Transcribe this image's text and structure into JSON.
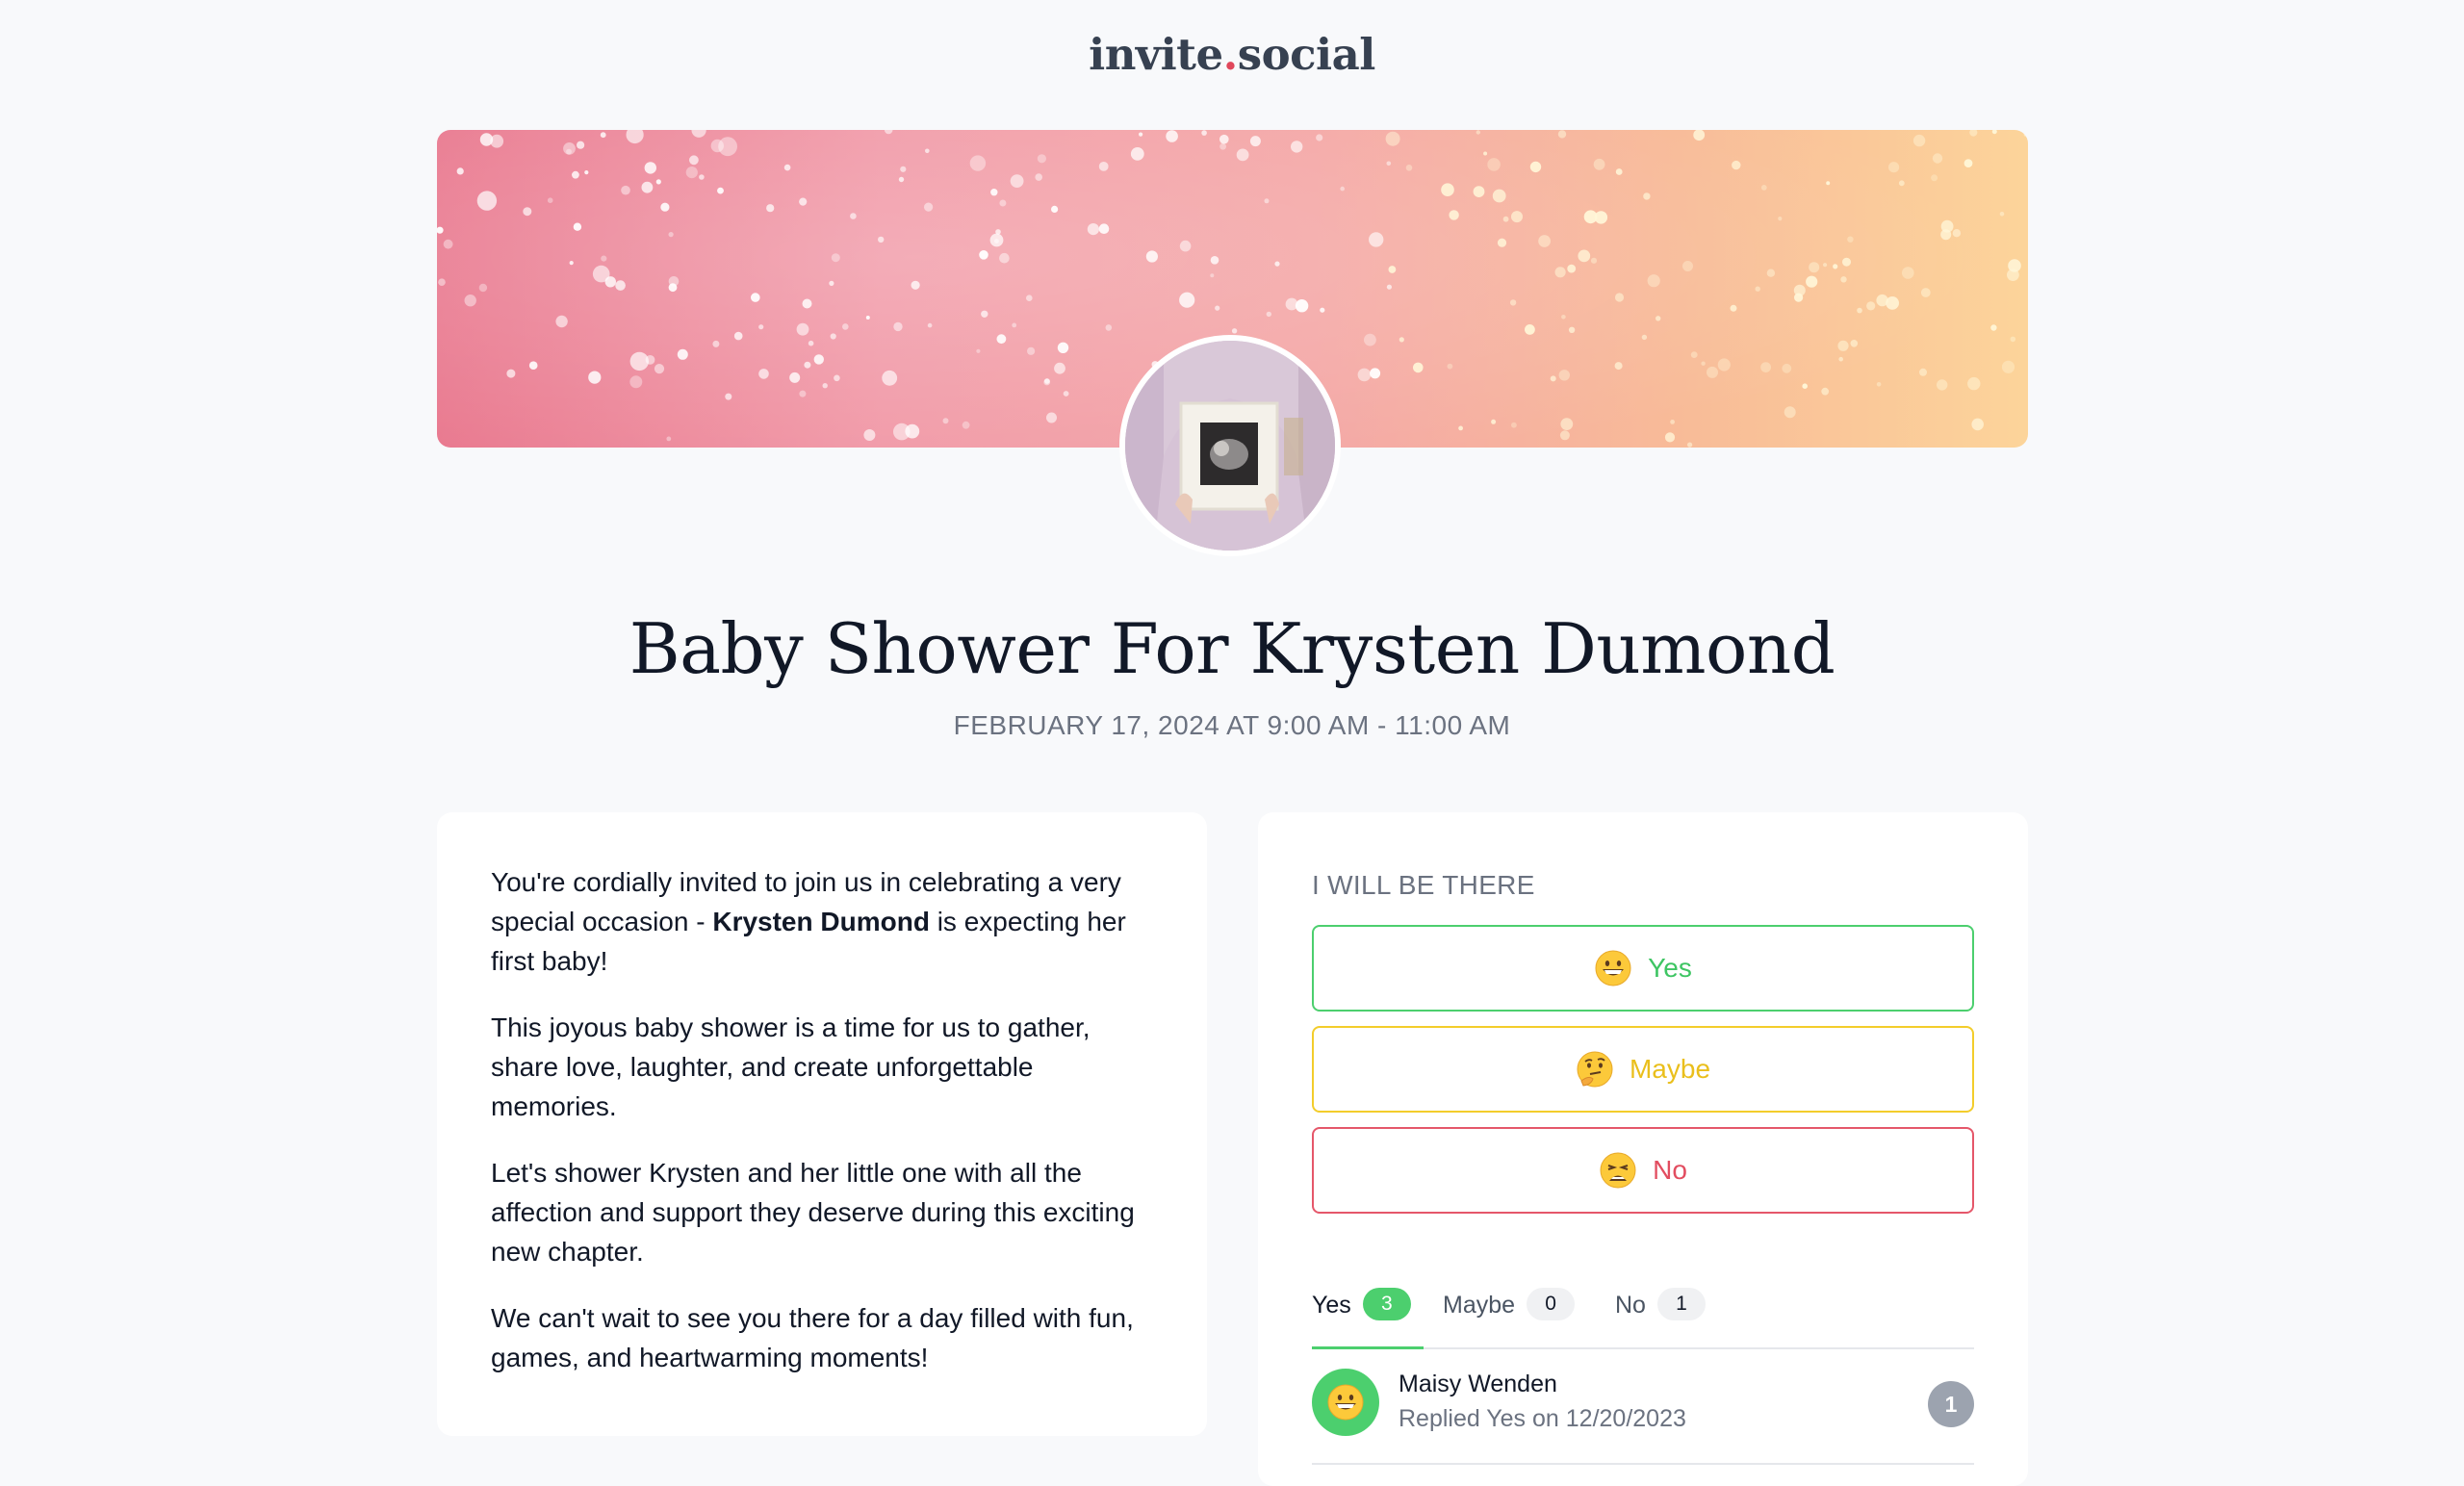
{
  "brand": {
    "name_part1": "invite",
    "name_dot": ".",
    "name_part2": "social"
  },
  "event": {
    "title": "Baby Shower For Krysten Dumond",
    "datetime": "FEBRUARY 17, 2024 AT 9:00 AM - 11:00 AM",
    "cover_image_icon": "sparkle-bokeh-banner",
    "avatar_icon": "ultrasound-photo-frame"
  },
  "description": {
    "p1_before": "You're cordially invited to join us in celebrating a very special occasion - ",
    "p1_bold": "Krysten Dumond",
    "p1_after": " is expecting her first baby!",
    "p2": "This joyous baby shower is a time for us to gather, share love, laughter, and create unforgettable memories.",
    "p3": "Let's shower Krysten and her little one with all the affection and support they deserve during this exciting new chapter.",
    "p4": "We can't wait to see you there for a day filled with fun, games, and heartwarming moments!"
  },
  "rsvp": {
    "heading": "I WILL BE THERE",
    "buttons": {
      "yes": {
        "label": "Yes",
        "icon": "grinning-face-icon",
        "color": "#3ec563"
      },
      "maybe": {
        "label": "Maybe",
        "icon": "thinking-face-icon",
        "color": "#eabf1c"
      },
      "no": {
        "label": "No",
        "icon": "weary-face-icon",
        "color": "#e24d60"
      }
    }
  },
  "responses": {
    "tabs": {
      "yes": {
        "label": "Yes",
        "count": "3"
      },
      "maybe": {
        "label": "Maybe",
        "count": "0"
      },
      "no": {
        "label": "No",
        "count": "1"
      }
    },
    "guests": [
      {
        "name": "Maisy Wenden",
        "status": "Replied Yes on 12/20/2023",
        "count": "1",
        "icon": "grinning-face-icon"
      }
    ]
  }
}
